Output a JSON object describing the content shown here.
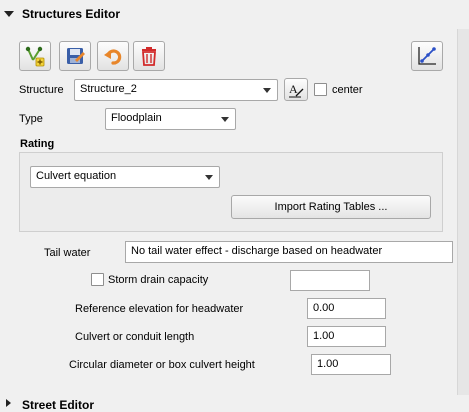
{
  "panel": {
    "title": "Structures Editor"
  },
  "toolbar": {
    "buttons": [
      {
        "icon": "add-structure-icon"
      },
      {
        "icon": "save-icon"
      },
      {
        "icon": "undo-icon"
      },
      {
        "icon": "delete-icon"
      }
    ],
    "schematize_icon": "schematize-icon"
  },
  "form": {
    "structure_label": "Structure",
    "structure_value": "Structure_2",
    "center_label": "center",
    "type_label": "Type",
    "type_value": "Floodplain"
  },
  "rating": {
    "title": "Rating",
    "method_value": "Culvert equation",
    "import_button": "Import Rating Tables ..."
  },
  "params": {
    "tail_water_label": "Tail water",
    "tail_water_value": "No tail water effect - discharge based on headwater",
    "storm_drain_label": "Storm drain capacity",
    "storm_drain_value": "",
    "ref_elev_label": "Reference elevation for headwater",
    "ref_elev_value": "0.00",
    "length_label": "Culvert or conduit length",
    "length_value": "1.00",
    "diameter_label": "Circular diameter or box culvert height",
    "diameter_value": "1.00"
  },
  "next_panel": {
    "title": "Street Editor"
  },
  "colors": {
    "accent_green": "#5a9e2f",
    "save_blue": "#3a5fa8",
    "undo_orange": "#e8862a",
    "delete_red": "#d22b2b"
  }
}
